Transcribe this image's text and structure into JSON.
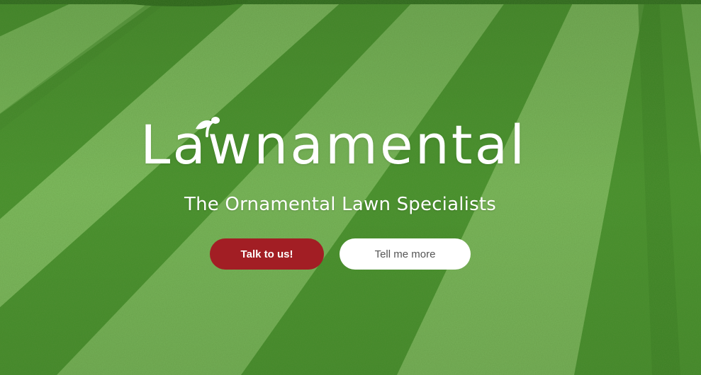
{
  "hero": {
    "brand": "Lawnamental",
    "tagline": "The Ornamental Lawn Specialists",
    "background": "striped-lawn-photo"
  },
  "buttons": {
    "talk_label": "Talk to us!",
    "more_label": "Tell me more"
  },
  "colors": {
    "primary_button": "#a21e24",
    "secondary_button": "#ffffff",
    "text": "#ffffff"
  },
  "icons": {
    "logo_mark": "sprout-icon"
  }
}
